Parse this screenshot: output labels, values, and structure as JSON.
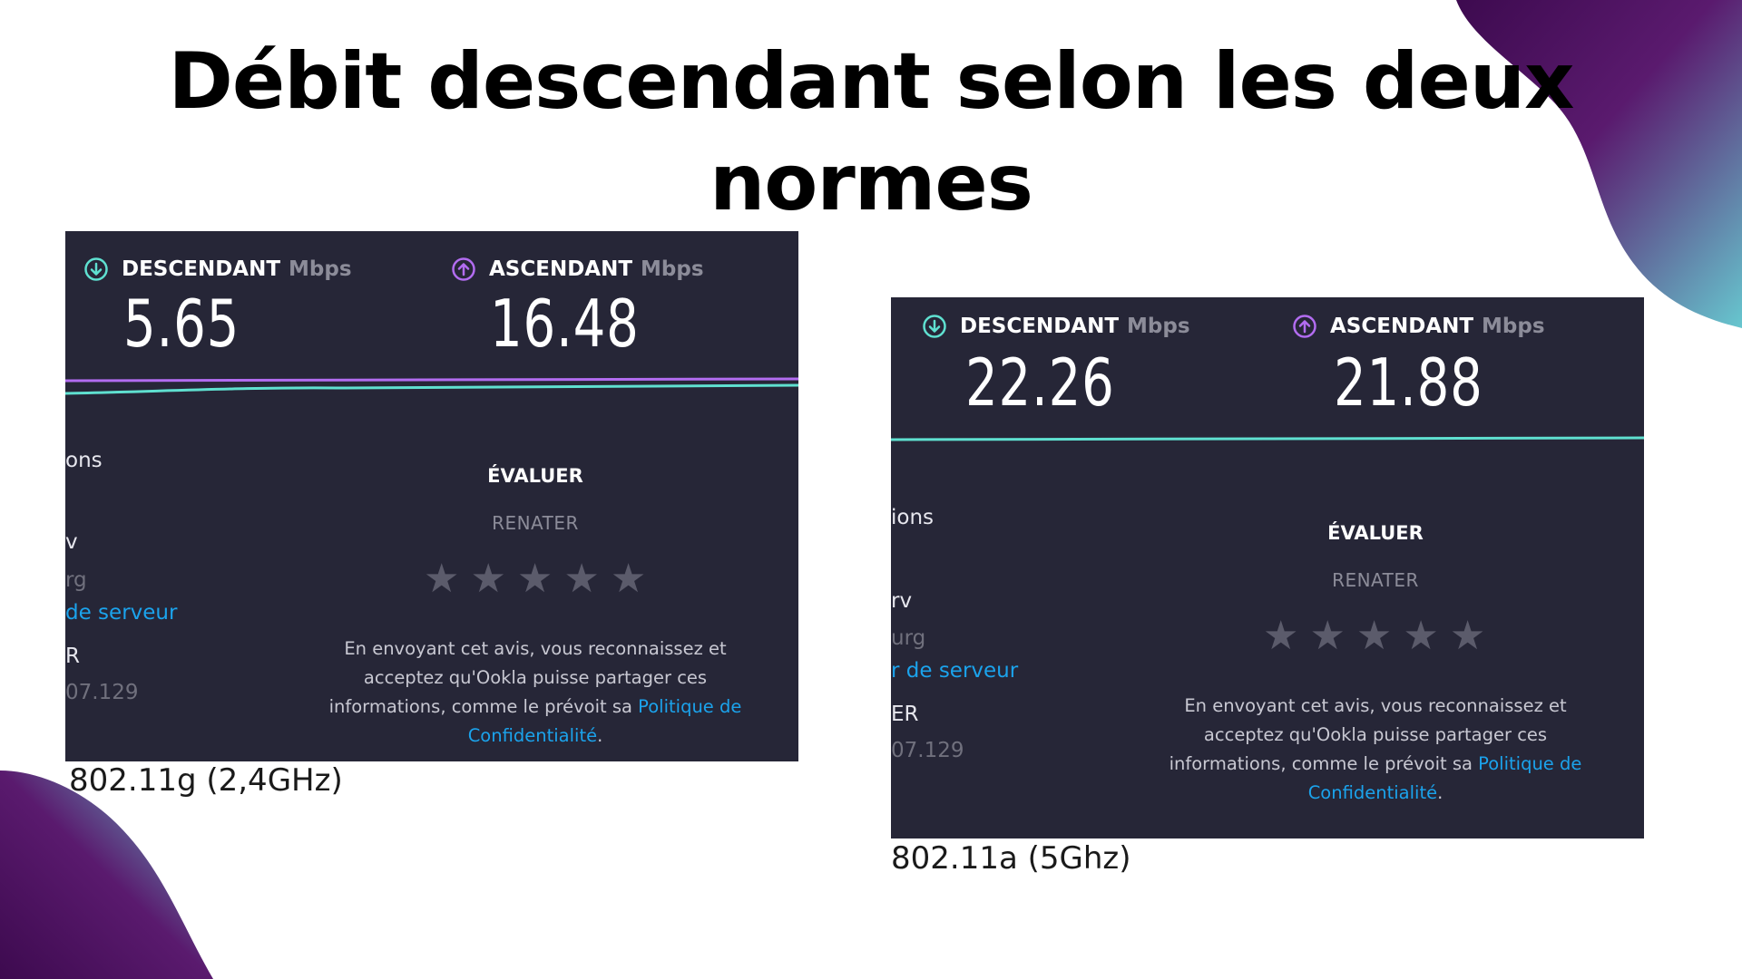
{
  "title": {
    "line1": "Débit descendant selon les deux",
    "line2": "normes"
  },
  "colors": {
    "panel_bg": "#262637",
    "download_accent": "#5fe0d0",
    "upload_accent": "#b26cf0",
    "link_blue": "#1ba3ec",
    "blob_dark": "#3d0a4f",
    "blob_light": "#67c7cf"
  },
  "shots": [
    {
      "download_label": "DESCENDANT",
      "upload_label": "ASCENDANT",
      "unit": "Mbps",
      "download_value": "5.65",
      "upload_value": "16.48",
      "download_icon": "download-arrow-icon",
      "upload_icon": "upload-arrow-icon",
      "side_text": [
        "ons",
        "v",
        "rg",
        "de serveur",
        "R",
        "07.129"
      ],
      "rate_label": "ÉVALUER",
      "isp_name": "RENATER",
      "stars": 5,
      "notice_line1": "En envoyant cet avis, vous reconnaissez et",
      "notice_line2": "acceptez qu'Ookla puisse partager ces",
      "notice_line3a": "informations, comme le prévoit sa ",
      "notice_link1": "Politique de",
      "notice_link2": "Confidentialité",
      "notice_end": ".",
      "caption": "802.11g (2,4GHz)"
    },
    {
      "download_label": "DESCENDANT",
      "upload_label": "ASCENDANT",
      "unit": "Mbps",
      "download_value": "22.26",
      "upload_value": "21.88",
      "download_icon": "download-arrow-icon",
      "upload_icon": "upload-arrow-icon",
      "side_text": [
        "ions",
        "rv",
        "urg",
        "r de serveur",
        "ER",
        "07.129"
      ],
      "rate_label": "ÉVALUER",
      "isp_name": "RENATER",
      "stars": 5,
      "notice_line1": "En envoyant cet avis, vous reconnaissez et",
      "notice_line2": "acceptez qu'Ookla puisse partager ces",
      "notice_line3a": "informations, comme le prévoit sa ",
      "notice_link1": "Politique de",
      "notice_link2": "Confidentialité",
      "notice_end": ".",
      "caption": "802.11a (5Ghz)"
    }
  ]
}
